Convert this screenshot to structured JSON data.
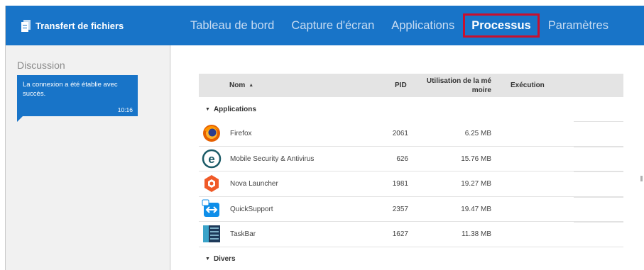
{
  "header": {
    "brand_title": "Transfert de fichiers",
    "brand_icon": "file-transfer-icon",
    "nav": [
      {
        "label": "Tableau de bord",
        "active": false
      },
      {
        "label": "Capture d'écran",
        "active": false
      },
      {
        "label": "Applications",
        "active": false
      },
      {
        "label": "Processus",
        "active": true
      },
      {
        "label": "Paramètres",
        "active": false
      }
    ]
  },
  "sidebar": {
    "title": "Discussion",
    "message": {
      "text": "La connexion a été établie avec succès.",
      "time": "10:16"
    }
  },
  "table": {
    "columns": {
      "name": "Nom",
      "pid": "PID",
      "memory": "Utilisation de la mé moire",
      "execution": "Exécution"
    },
    "groups": [
      {
        "label": "Applications",
        "rows": [
          {
            "name": "Firefox",
            "pid": "2061",
            "memory": "6.25 MB",
            "icon": "firefox-icon"
          },
          {
            "name": "Mobile Security & Antivirus",
            "pid": "626",
            "memory": "15.76 MB",
            "icon": "eset-security-icon"
          },
          {
            "name": "Nova Launcher",
            "pid": "1981",
            "memory": "19.27 MB",
            "icon": "nova-launcher-icon"
          },
          {
            "name": "QuickSupport",
            "pid": "2357",
            "memory": "19.47 MB",
            "icon": "quicksupport-icon"
          },
          {
            "name": "TaskBar",
            "pid": "1627",
            "memory": "11.38 MB",
            "icon": "taskbar-icon"
          }
        ]
      },
      {
        "label": "Divers",
        "rows": []
      }
    ]
  },
  "colors": {
    "header_bg": "#1874c8",
    "active_outline": "#c8102e",
    "sidebar_bg": "#f1f1f1",
    "table_header_bg": "#e4e4e4"
  }
}
